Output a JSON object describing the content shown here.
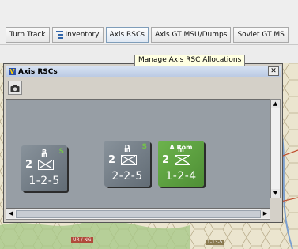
{
  "toolbar": {
    "tabs": [
      {
        "label": "Turn Track"
      },
      {
        "label": "Inventory"
      },
      {
        "label": "Axis RSCs"
      },
      {
        "label": "Axis GT MSU/Dumps"
      },
      {
        "label": "Soviet GT MS"
      }
    ],
    "tooltip": "Manage Axis RSC Allocations"
  },
  "window": {
    "title": "Axis RSCs",
    "close_label": "✕"
  },
  "counters": [
    {
      "top": "B",
      "size": "III",
      "num": "2",
      "strength": "1-2-5",
      "color": "grey",
      "status": "S"
    },
    {
      "top": "D",
      "size": "III",
      "num": "2",
      "strength": "2-2-5",
      "color": "grey",
      "status": "S"
    },
    {
      "top": "A Rom",
      "size": "III",
      "num": "2",
      "strength": "1-2-4",
      "color": "green",
      "status": ""
    }
  ],
  "map": {
    "labels": [
      "UR / NG",
      "1-13-5"
    ]
  },
  "scroll": {
    "up": "▲",
    "down": "▼",
    "left": "◀",
    "right": "▶"
  }
}
